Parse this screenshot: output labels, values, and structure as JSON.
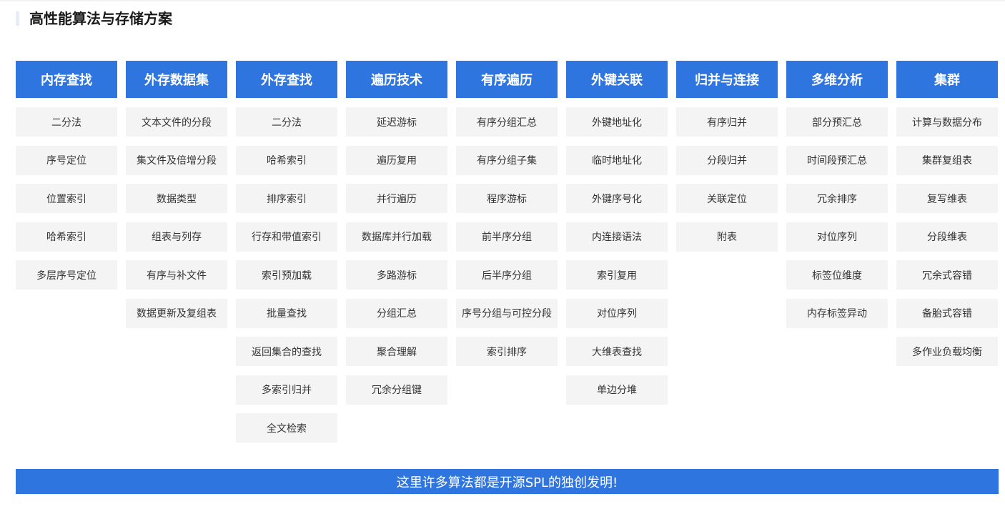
{
  "section": {
    "title": "高性能算法与存储方案"
  },
  "columns": [
    {
      "header": "内存查找",
      "items": [
        "二分法",
        "序号定位",
        "位置索引",
        "哈希索引",
        "多层序号定位"
      ]
    },
    {
      "header": "外存数据集",
      "items": [
        "文本文件的分段",
        "集文件及倍增分段",
        "数据类型",
        "组表与列存",
        "有序与补文件",
        "数据更新及复组表"
      ]
    },
    {
      "header": "外存查找",
      "items": [
        "二分法",
        "哈希索引",
        "排序索引",
        "行存和带值索引",
        "索引预加载",
        "批量查找",
        "返回集合的查找",
        "多索引归并",
        "全文检索"
      ]
    },
    {
      "header": "遍历技术",
      "items": [
        "延迟游标",
        "遍历复用",
        "并行遍历",
        "数据库并行加载",
        "多路游标",
        "分组汇总",
        "聚合理解",
        "冗余分组键"
      ]
    },
    {
      "header": "有序遍历",
      "items": [
        "有序分组汇总",
        "有序分组子集",
        "程序游标",
        "前半序分组",
        "后半序分组",
        "序号分组与可控分段",
        "索引排序"
      ]
    },
    {
      "header": "外键关联",
      "items": [
        "外键地址化",
        "临时地址化",
        "外键序号化",
        "内连接语法",
        "索引复用",
        "对位序列",
        "大维表查找",
        "单边分堆"
      ]
    },
    {
      "header": "归并与连接",
      "items": [
        "有序归并",
        "分段归并",
        "关联定位",
        "附表"
      ]
    },
    {
      "header": "多维分析",
      "items": [
        "部分预汇总",
        "时间段预汇总",
        "冗余排序",
        "对位序列",
        "标签位维度",
        "内存标签异动"
      ]
    },
    {
      "header": "集群",
      "items": [
        "计算与数据分布",
        "集群复组表",
        "复写维表",
        "分段维表",
        "冗余式容错",
        "备胎式容错",
        "多作业负载均衡"
      ]
    }
  ],
  "banner": {
    "text": "这里许多算法都是开源SPL的独创发明!"
  }
}
